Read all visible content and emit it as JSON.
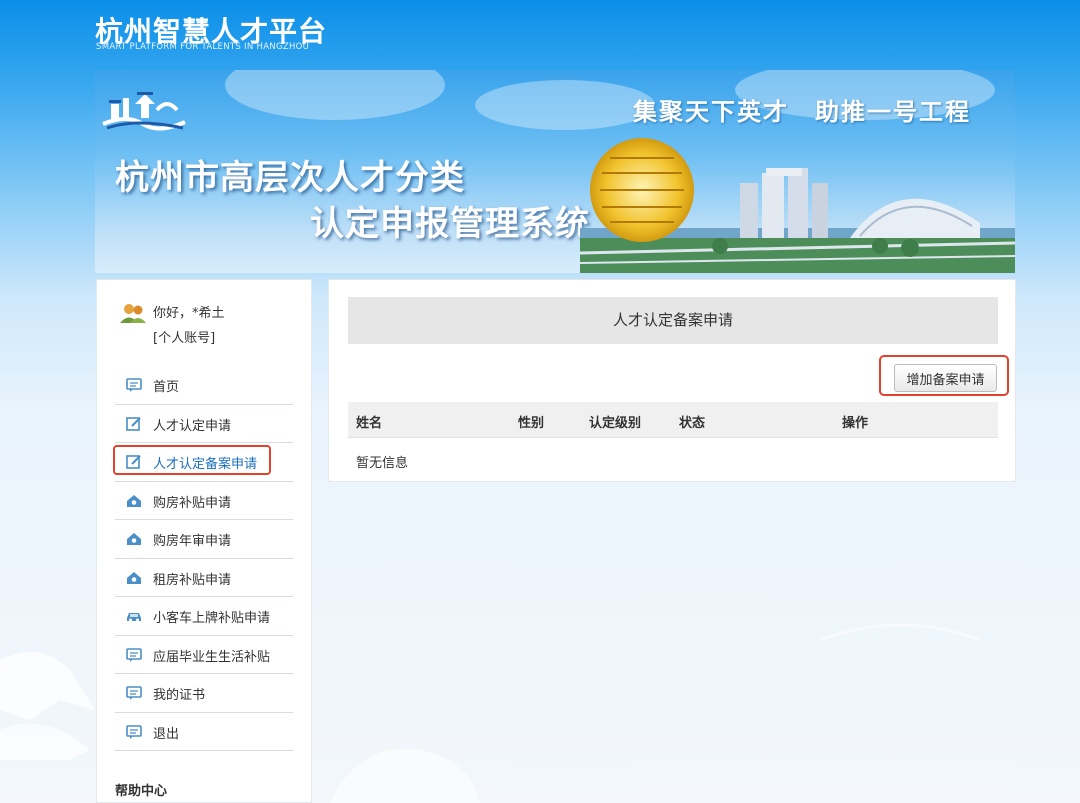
{
  "header": {
    "logo_cn": "杭州智慧人才平台",
    "logo_en": "SMART PLATFORM FOR TALENTS IN HANGZHOU"
  },
  "banner": {
    "slogan": "集聚天下英才　助推一号工程",
    "title_line1": "杭州市高层次人才分类",
    "title_line2": "认定申报管理系统"
  },
  "user": {
    "greeting": "你好，*希土",
    "account_link": "[个人账号]"
  },
  "sidebar": {
    "items": [
      {
        "label": "首页",
        "icon": "message-icon"
      },
      {
        "label": "人才认定申请",
        "icon": "edit-icon"
      },
      {
        "label": "人才认定备案申请",
        "icon": "edit-icon",
        "active": true
      },
      {
        "label": "购房补贴申请",
        "icon": "house-icon"
      },
      {
        "label": "购房年审申请",
        "icon": "house-icon"
      },
      {
        "label": "租房补贴申请",
        "icon": "house-icon"
      },
      {
        "label": "小客车上牌补贴申请",
        "icon": "car-icon"
      },
      {
        "label": "应届毕业生生活补贴",
        "icon": "message-icon"
      },
      {
        "label": "我的证书",
        "icon": "message-icon"
      },
      {
        "label": "退出",
        "icon": "message-icon"
      }
    ],
    "help_title": "帮助中心"
  },
  "main": {
    "panel_title": "人才认定备案申请",
    "add_button": "增加备案申请",
    "columns": [
      "姓名",
      "性别",
      "认定级别",
      "状态",
      "操作"
    ],
    "empty_text": "暂无信息"
  },
  "colors": {
    "header_blue": "#0b8fe9",
    "highlight_red": "#e2412b",
    "icon_blue": "#4a8fc7",
    "active_text": "#1a6fc0"
  }
}
